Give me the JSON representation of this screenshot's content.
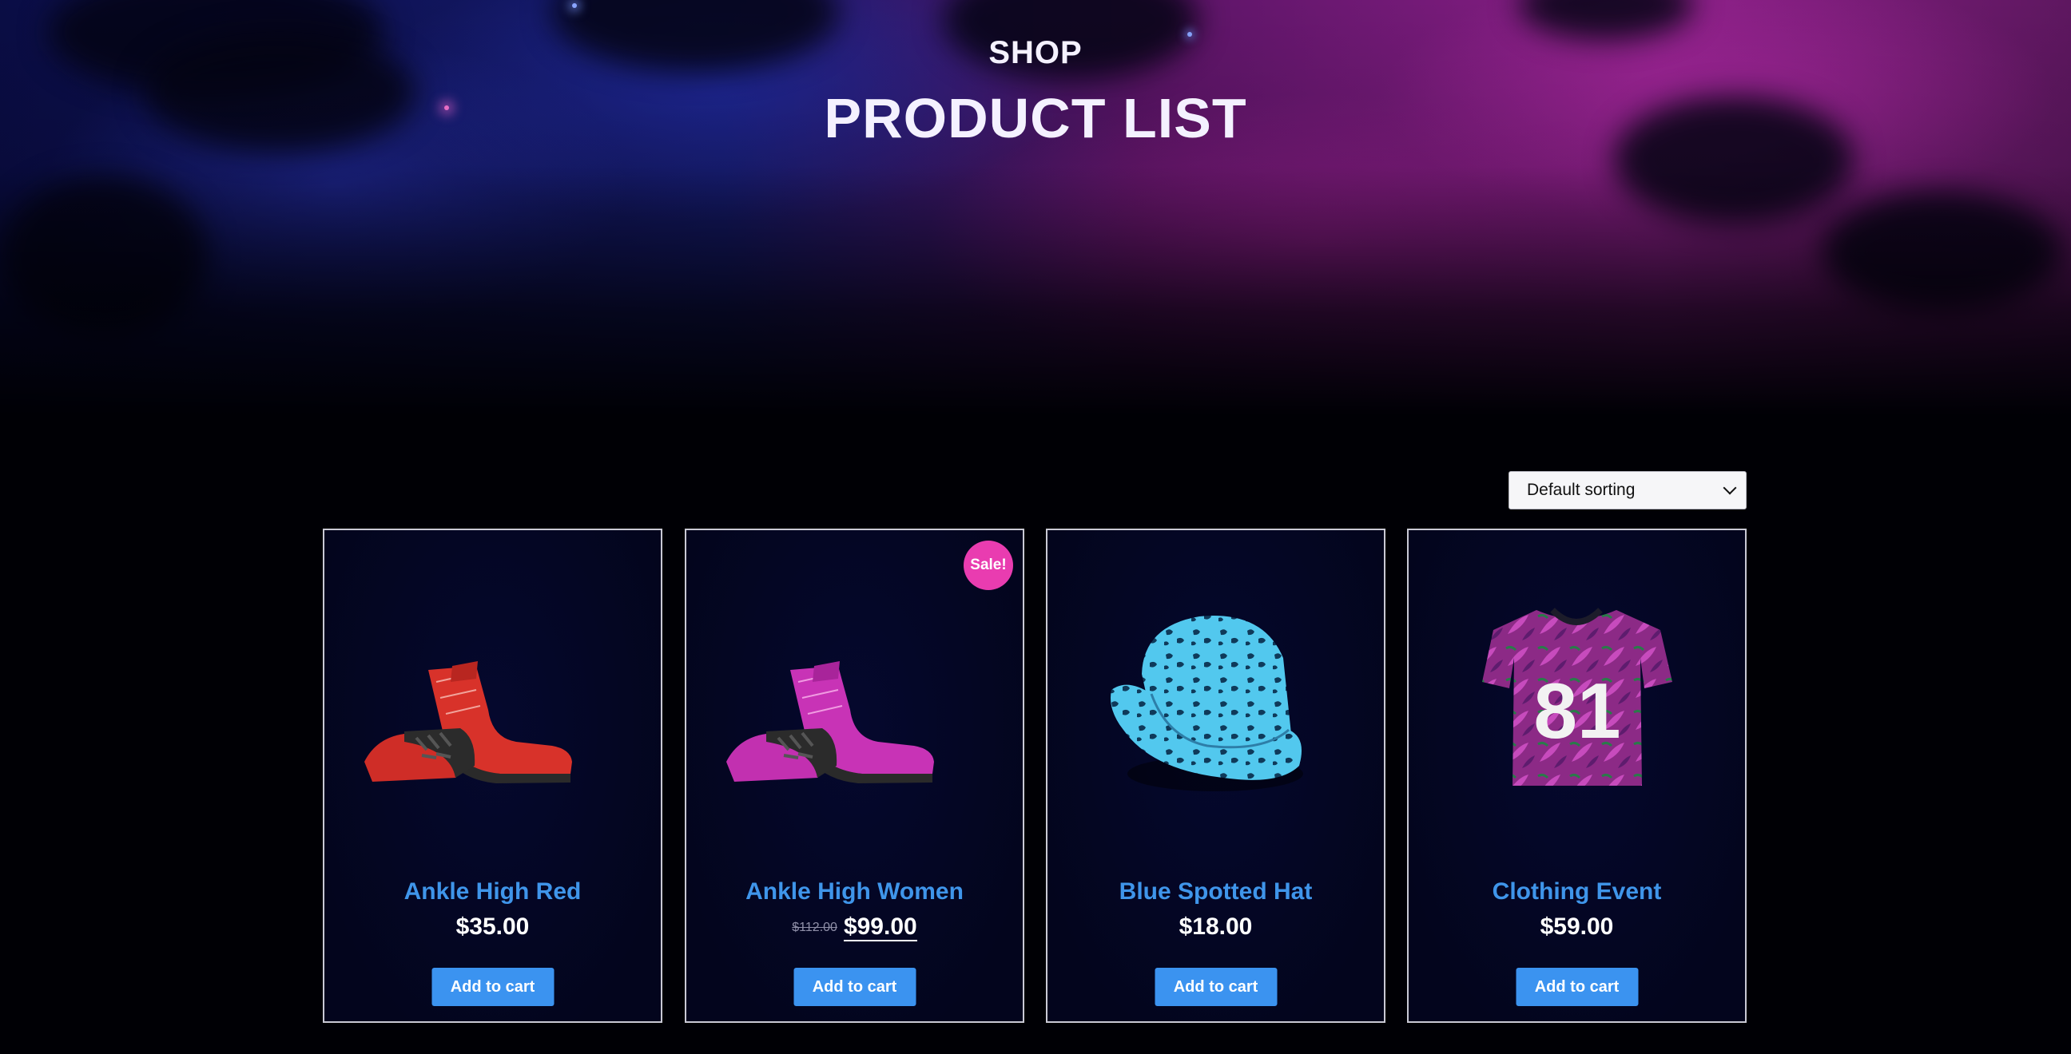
{
  "hero": {
    "subtitle": "SHOP",
    "title": "PRODUCT LIST"
  },
  "sort": {
    "selected": "Default sorting"
  },
  "products": [
    {
      "name": "Ankle High Red",
      "price": "$35.00",
      "button": "Add to cart",
      "image": "red-ankle-boots",
      "color": "#d8322a"
    },
    {
      "name": "Ankle High Women",
      "old_price": "$112.00",
      "price": "$99.00",
      "button": "Add to cart",
      "badge": "Sale!",
      "image": "magenta-ankle-boots",
      "color": "#c833b6"
    },
    {
      "name": "Blue Spotted Hat",
      "price": "$18.00",
      "button": "Add to cart",
      "image": "blue-leopard-bucket-hat",
      "color": "#4fc4ea"
    },
    {
      "name": "Clothing Event",
      "price": "$59.00",
      "button": "Add to cart",
      "image": "purple-jersey-tshirt",
      "jersey_number": "81",
      "color": "#9a2f8e"
    }
  ],
  "colors": {
    "accent_blue": "#3b93f0",
    "title_blue": "#3f95ea",
    "sale_pink": "#e93cb0",
    "background": "#000005"
  }
}
